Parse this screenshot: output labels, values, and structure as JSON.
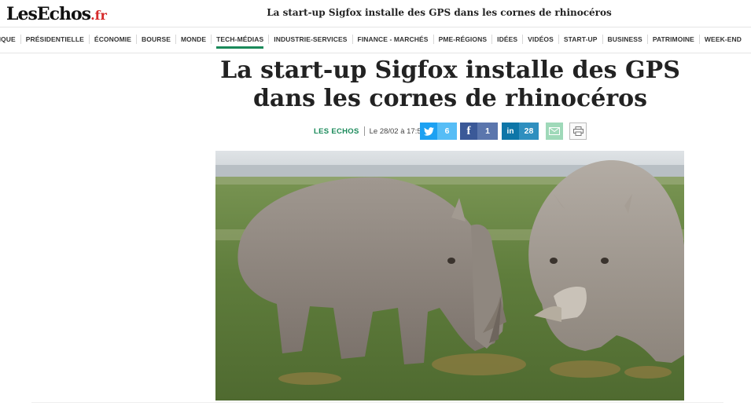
{
  "header": {
    "logo_main": "LesEchos",
    "logo_suffix": ".fr",
    "top_title": "La start-up Sigfox installe des GPS dans les cornes de rhinocéros"
  },
  "nav": {
    "items": [
      "POLITIQUE",
      "PRÉSIDENTIELLE",
      "ÉCONOMIE",
      "BOURSE",
      "MONDE",
      "TECH-MÉDIAS",
      "INDUSTRIE-SERVICES",
      "FINANCE - MARCHÉS",
      "PME-RÉGIONS",
      "IDÉES",
      "VIDÉOS",
      "START-UP",
      "BUSINESS",
      "PATRIMOINE",
      "WEEK-END"
    ],
    "active": "TECH-MÉDIAS"
  },
  "article": {
    "headline": "La start-up Sigfox installe des GPS dans les cornes de rhinocéros",
    "source": "LES ECHOS",
    "date": "Le 28/02 à 17:50"
  },
  "share": {
    "twitter_count": "6",
    "facebook_count": "1",
    "facebook_icon": "f",
    "linkedin_count": "28",
    "linkedin_icon": "in"
  },
  "icons": {
    "twitter": "twitter-icon",
    "facebook": "facebook-icon",
    "linkedin": "linkedin-icon",
    "mail": "mail-icon",
    "print": "print-icon"
  },
  "colors": {
    "accent_green": "#1a8a5a",
    "logo_red": "#d62b2b",
    "twitter": "#1da1f2",
    "facebook": "#3b5998",
    "linkedin": "#0e76a8",
    "mail": "#9fd9b9"
  }
}
